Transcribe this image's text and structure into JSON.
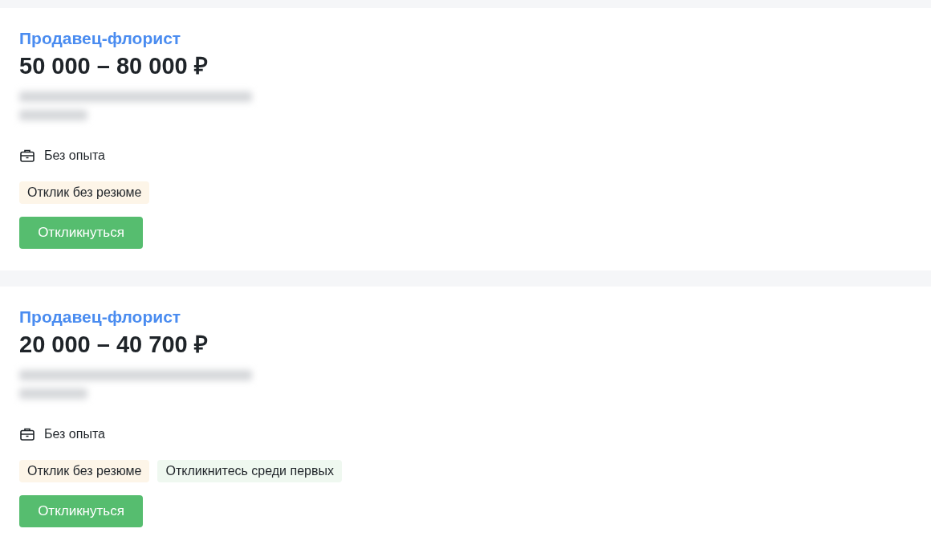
{
  "vacancies": [
    {
      "title": "Продавец-флорист",
      "salary": "50 000 – 80 000 ₽",
      "experience": "Без опыта",
      "tags": [
        {
          "text": "Отклик без резюме",
          "color": "#fdf5e8"
        }
      ],
      "button": "Откликнуться"
    },
    {
      "title": "Продавец-флорист",
      "salary": "20 000 – 40 700 ₽",
      "experience": "Без опыта",
      "tags": [
        {
          "text": "Отклик без резюме",
          "color": "#fdf5e8"
        },
        {
          "text": "Откликнитесь среди первых",
          "color": "#eff8f0"
        }
      ],
      "button": "Откликнуться"
    }
  ]
}
